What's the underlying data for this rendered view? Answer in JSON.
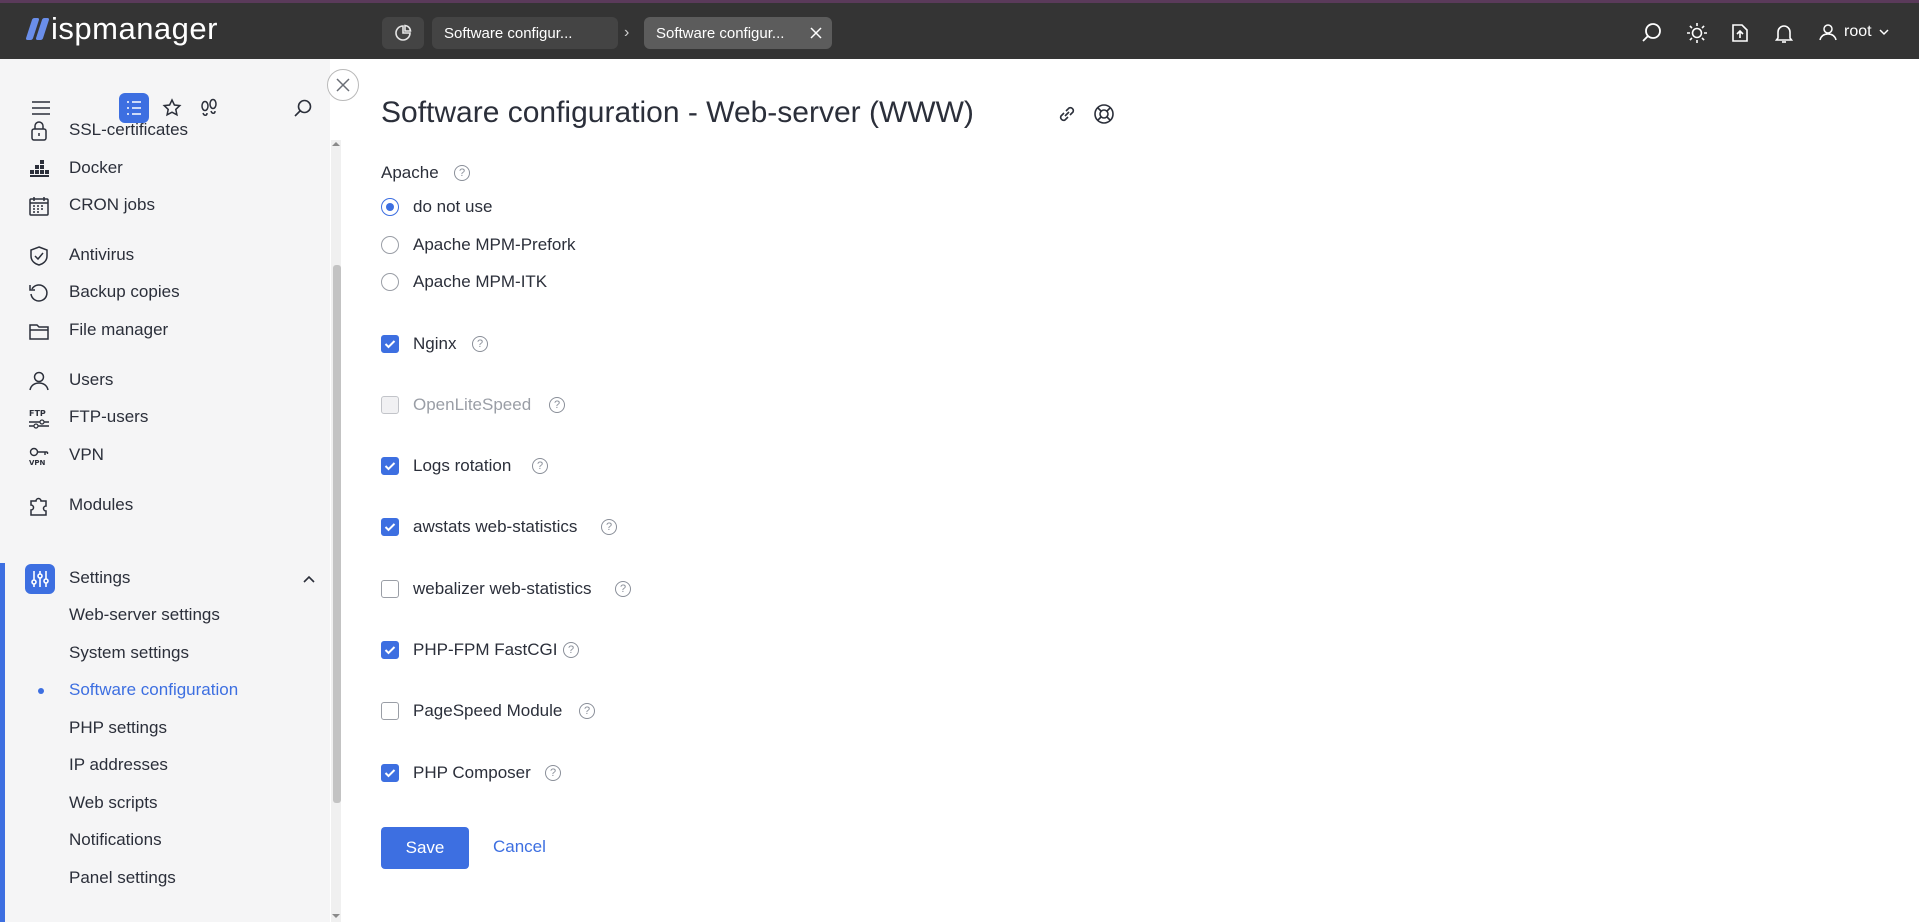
{
  "app": {
    "logo_text": "ispmanager"
  },
  "topbar": {
    "tabs": [
      {
        "label": "Software configur..."
      },
      {
        "label": "Software configur..."
      }
    ],
    "user": "root"
  },
  "sidebar": {
    "items": [
      {
        "label": "SSL-certificates",
        "icon": "lock-icon"
      },
      {
        "label": "Docker",
        "icon": "docker-icon"
      },
      {
        "label": "CRON jobs",
        "icon": "calendar-icon"
      },
      {
        "label": "Antivirus",
        "icon": "shield-icon"
      },
      {
        "label": "Backup copies",
        "icon": "history-icon"
      },
      {
        "label": "File manager",
        "icon": "folder-icon"
      },
      {
        "label": "Users",
        "icon": "user-icon"
      },
      {
        "label": "FTP-users",
        "icon": "ftp-icon"
      },
      {
        "label": "VPN",
        "icon": "vpn-icon"
      },
      {
        "label": "Modules",
        "icon": "puzzle-icon"
      }
    ],
    "settings": {
      "label": "Settings",
      "subitems": [
        "Web-server settings",
        "System settings",
        "Software configuration",
        "PHP settings",
        "IP addresses",
        "Web scripts",
        "Notifications",
        "Panel settings"
      ],
      "active_index": 2
    },
    "ftp_icon_text": "FTP",
    "vpn_icon_text": "VPN"
  },
  "main": {
    "title": "Software configuration - Web-server (WWW)",
    "apache_label": "Apache",
    "apache_options": [
      {
        "label": "do not use",
        "checked": true
      },
      {
        "label": "Apache MPM-Prefork",
        "checked": false
      },
      {
        "label": "Apache MPM-ITK",
        "checked": false
      }
    ],
    "checkboxes": [
      {
        "label": "Nginx",
        "checked": true,
        "disabled": false
      },
      {
        "label": "OpenLiteSpeed",
        "checked": false,
        "disabled": true
      },
      {
        "label": "Logs rotation",
        "checked": true,
        "disabled": false
      },
      {
        "label": "awstats web-statistics",
        "checked": true,
        "disabled": false
      },
      {
        "label": "webalizer web-statistics",
        "checked": false,
        "disabled": false
      },
      {
        "label": "PHP-FPM FastCGI",
        "checked": true,
        "disabled": false
      },
      {
        "label": "PageSpeed Module",
        "checked": false,
        "disabled": false
      },
      {
        "label": "PHP Composer",
        "checked": true,
        "disabled": false
      }
    ],
    "help_glyph": "?",
    "save_label": "Save",
    "cancel_label": "Cancel"
  },
  "colors": {
    "accent": "#3d6fe1",
    "topbar": "#343434",
    "sidebar": "#f5f5f6"
  }
}
